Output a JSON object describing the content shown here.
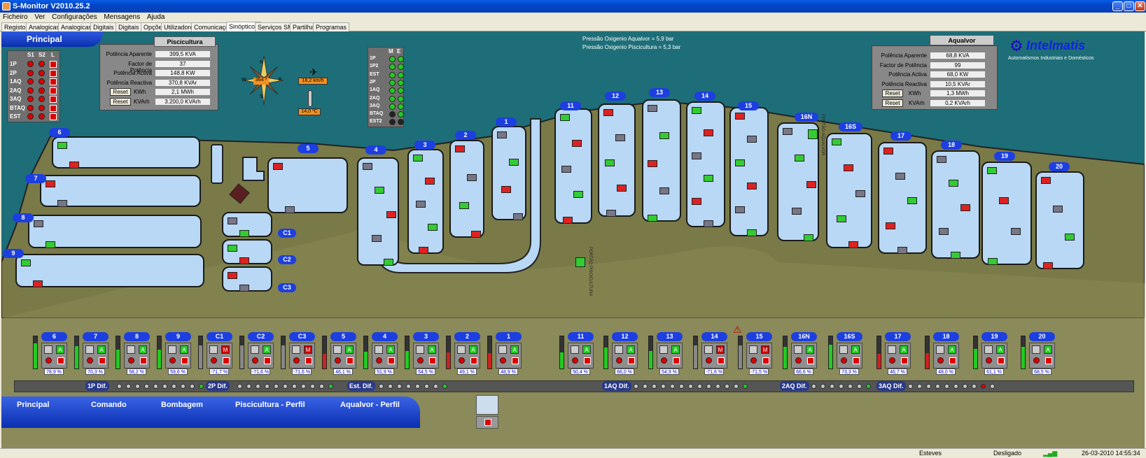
{
  "window": {
    "title": "S-Monitor V2010.25.2",
    "min": "_",
    "max": "□",
    "close": "✕"
  },
  "menu": [
    "Ficheiro",
    "Ver",
    "Configurações",
    "Mensagens",
    "Ajuda"
  ],
  "tabs": [
    "Registos",
    "Analogicas 1",
    "Analogicas 2",
    "Digitais 1",
    "Digitais 2",
    "Opções",
    "Utilizadores",
    "Comunicações",
    "Sinópticos",
    "Serviços SMS",
    "Partilhas",
    "Programas"
  ],
  "active_tab": "Sinópticos",
  "nav_top": "Principal",
  "pressure": {
    "line1": "Pressão Oxigenio Aqualvor = 5,9 bar",
    "line2": "Pressão Oxigenio Piscicultura = 5,3 bar"
  },
  "left_lamps": {
    "headers": [
      "S1",
      "S2",
      "L"
    ],
    "rows": [
      "1P",
      "2P",
      "1AQ",
      "2AQ",
      "3AQ",
      "BTAQ",
      "EST"
    ]
  },
  "mid_lamps": {
    "headers": [
      "M",
      "E"
    ],
    "rows": [
      "1P",
      "1P2",
      "EST",
      "2P",
      "1AQ",
      "2AQ",
      "3AQ",
      "BTAQ",
      "EST2"
    ]
  },
  "piscicultura": {
    "title": "Piscicultura",
    "rows": [
      {
        "label": "Potência Aparente",
        "value": "399,5 KVA"
      },
      {
        "label": "Factor de Potência",
        "value": "37"
      },
      {
        "label": "Potência Activa",
        "value": "148,8 KW"
      },
      {
        "label": "Potência Reactiva",
        "value": "370,8 KVAr"
      },
      {
        "label": "KWh",
        "value": "2,1 MWh",
        "reset": "Reset"
      },
      {
        "label": "KVArh",
        "value": "3.200,0 KVArh",
        "reset": "Reset"
      }
    ]
  },
  "aqualvor": {
    "title": "Aqualvor",
    "rows": [
      {
        "label": "Potência Aparente",
        "value": "68,8 KVA"
      },
      {
        "label": "Factor de Potência",
        "value": "99"
      },
      {
        "label": "Potência Activa",
        "value": "68,0 KW"
      },
      {
        "label": "Potência Reactiva",
        "value": "10,5 KVAr"
      },
      {
        "label": "KWh",
        "value": "1,3 MWh",
        "reset": "Reset"
      },
      {
        "label": "KVArh",
        "value": "0,2 KVArh",
        "reset": "Reset"
      }
    ]
  },
  "weather": {
    "heading": "364 º",
    "wind": "18,2 km/h",
    "temp": "14,0 ºC",
    "n": "N",
    "s": "S",
    "e": "E",
    "w": "W"
  },
  "logo": {
    "name": "Intelmatis",
    "tagline": "Automatismos Industriais e Domésticos"
  },
  "gates": {
    "left": "PORTÃO PISCICULTURA",
    "right": "PORTÃO AQUALVOR"
  },
  "pond_tags": [
    "6",
    "7",
    "8",
    "9",
    "5",
    "4",
    "3",
    "2",
    "1",
    "11",
    "12",
    "13",
    "14",
    "15",
    "16N",
    "16S",
    "17",
    "18",
    "19",
    "20",
    "C1",
    "C2",
    "C3"
  ],
  "cards": [
    {
      "id": "6",
      "pct": "78,9 %",
      "m": "A"
    },
    {
      "id": "7",
      "pct": "70,3 %",
      "m": "A"
    },
    {
      "id": "8",
      "pct": "58,2 %",
      "m": "A"
    },
    {
      "id": "9",
      "pct": "59,6 %",
      "m": "A"
    },
    {
      "id": "C1",
      "pct": "-71,7 %",
      "m": "M"
    },
    {
      "id": "C2",
      "pct": "-71,6 %",
      "m": "A"
    },
    {
      "id": "C3",
      "pct": "-71,6 %",
      "m": "M"
    },
    {
      "id": "5",
      "pct": "46,1 %",
      "m": "A"
    },
    {
      "id": "4",
      "pct": "51,9 %",
      "m": "A"
    },
    {
      "id": "3",
      "pct": "54,5 %",
      "m": "A"
    },
    {
      "id": "2",
      "pct": "49,1 %",
      "m": "A"
    },
    {
      "id": "1",
      "pct": "48,9 %",
      "m": "A"
    },
    {
      "id": "11",
      "pct": "50,4 %",
      "m": "A"
    },
    {
      "id": "12",
      "pct": "66,0 %",
      "m": "A"
    },
    {
      "id": "13",
      "pct": "54,9 %",
      "m": "A"
    },
    {
      "id": "14",
      "pct": "-71,6 %",
      "m": "M"
    },
    {
      "id": "15",
      "pct": "-71,5 %",
      "m": "M"
    },
    {
      "id": "16N",
      "pct": "66,6 %",
      "m": "A"
    },
    {
      "id": "16S",
      "pct": "73,3 %",
      "m": "A"
    },
    {
      "id": "17",
      "pct": "46,7 %",
      "m": "A"
    },
    {
      "id": "18",
      "pct": "48,0 %",
      "m": "A"
    },
    {
      "id": "19",
      "pct": "61,1 %",
      "m": "A"
    },
    {
      "id": "20",
      "pct": "68,5 %",
      "m": "A"
    }
  ],
  "dif": {
    "p1": "1P Dif.",
    "p2": "2P Dif.",
    "est": "Est. Dif.",
    "aq1": "1AQ Dif.",
    "aq2": "2AQ Dif.",
    "aq3": "3AQ Dif.",
    "est_label": "Est."
  },
  "nav_bottom": [
    "Principal",
    "Comando",
    "Bombagem",
    "Piscicultura - Perfil",
    "Aqualvor  - Perfil"
  ],
  "status": {
    "user": "Esteves",
    "state": "Desligado",
    "datetime": "26-03-2010 14:55:34"
  }
}
